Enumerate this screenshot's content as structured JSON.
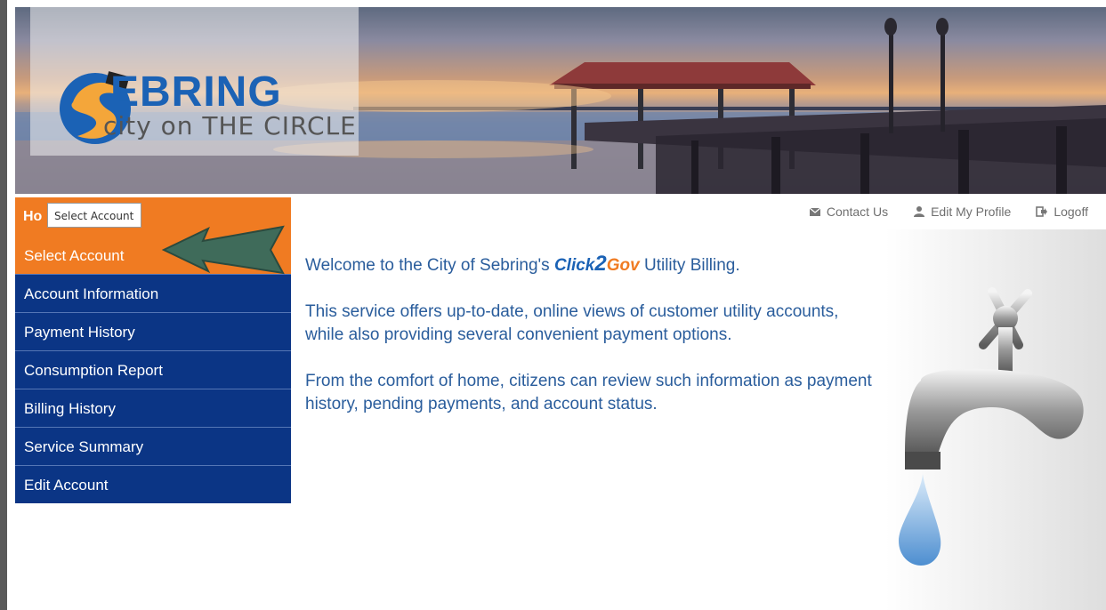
{
  "banner": {
    "logo_word": "EBRING",
    "logo_tagline": "city on THE CIRCLE"
  },
  "sidebar": {
    "header_label": "Ho",
    "tooltip": "Select Account",
    "items": [
      {
        "label": "Select Account",
        "active": true
      },
      {
        "label": "Account Information"
      },
      {
        "label": "Payment History"
      },
      {
        "label": "Consumption Report"
      },
      {
        "label": "Billing History"
      },
      {
        "label": "Service Summary"
      },
      {
        "label": "Edit Account"
      }
    ]
  },
  "toplinks": {
    "contact": "Contact Us",
    "profile": "Edit My Profile",
    "logoff": "Logoff"
  },
  "content": {
    "welcome_prefix": "Welcome to the City of Sebring's ",
    "brand_click": "Click",
    "brand_2": "2",
    "brand_gov": "Gov",
    "welcome_suffix": "  Utility Billing.",
    "para2": "This service offers up-to-date, online views of customer utility accounts, while also providing several convenient payment options.",
    "para3": "From the comfort of home, citizens can review such information as payment history, pending payments, and account status."
  },
  "colors": {
    "orange": "#f07b22",
    "navy": "#0b3585",
    "text_blue": "#2a5d9c",
    "arrow_green": "#3f6b5a"
  }
}
